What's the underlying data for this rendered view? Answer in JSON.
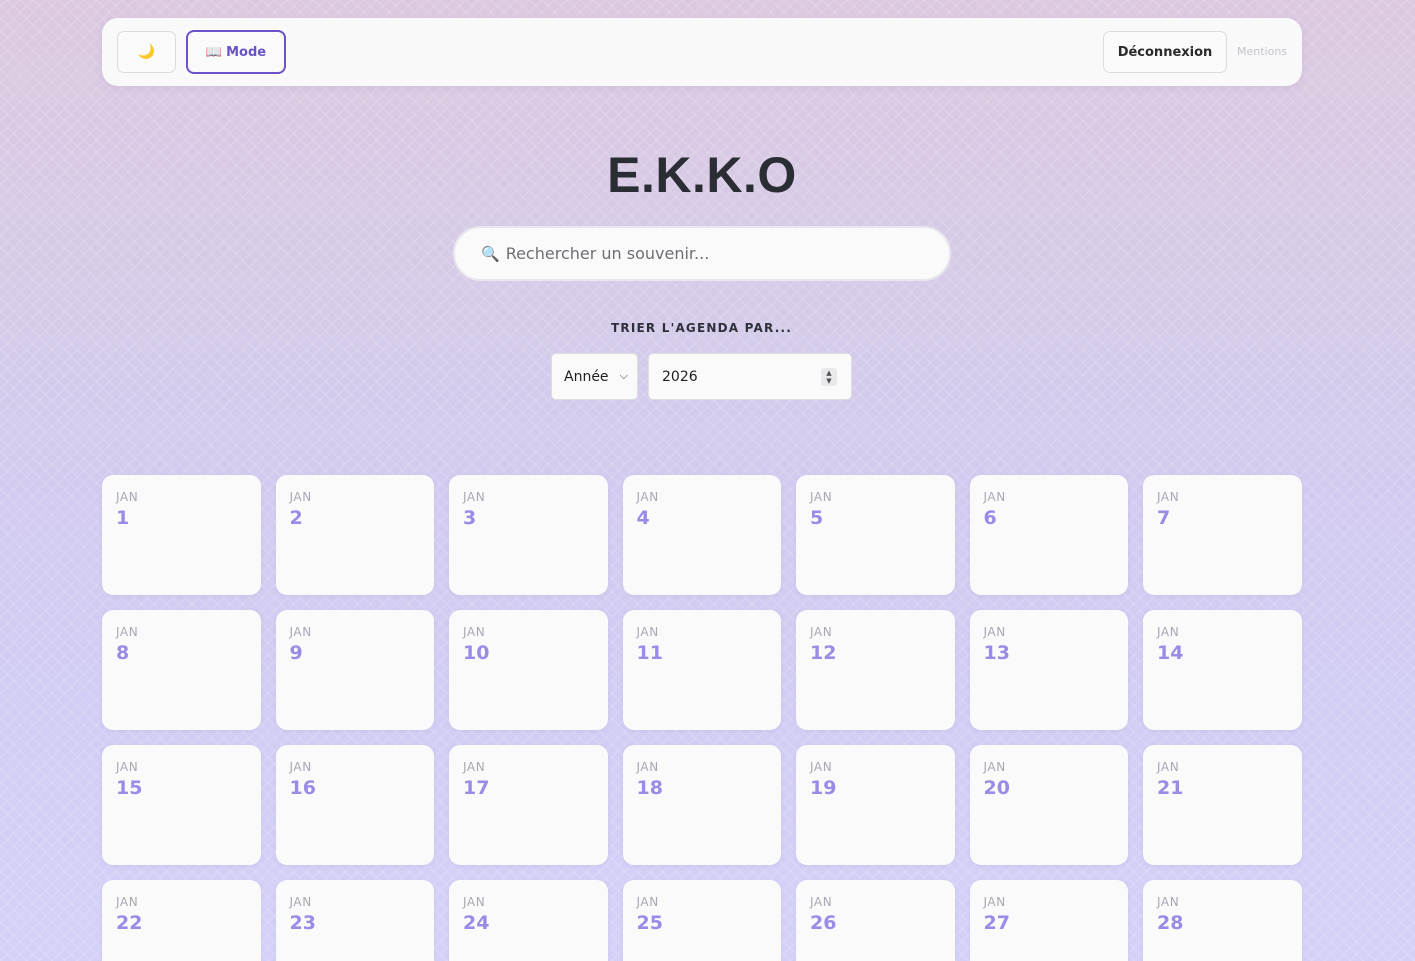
{
  "topbar": {
    "theme_icon": "moon-icon",
    "mode_icon": "book-icon",
    "mode_label": "Mode",
    "logout_label": "Déconnexion",
    "mentions_label": "Mentions"
  },
  "app": {
    "title": "E.K.K.O"
  },
  "search": {
    "placeholder": "Rechercher un souvenir..."
  },
  "sort": {
    "label": "TRIER L'AGENDA PAR...",
    "select_value": "Année",
    "year_value": "2026"
  },
  "calendar": {
    "month_label": "JAN",
    "days": [
      "1",
      "2",
      "3",
      "4",
      "5",
      "6",
      "7",
      "8",
      "9",
      "10",
      "11",
      "12",
      "13",
      "14",
      "15",
      "16",
      "17",
      "18",
      "19",
      "20",
      "21",
      "22",
      "23",
      "24",
      "25",
      "26",
      "27",
      "28"
    ]
  },
  "colors": {
    "accent": "#6b52c6",
    "day_number": "#9a8be6",
    "title": "#2b2d35"
  }
}
